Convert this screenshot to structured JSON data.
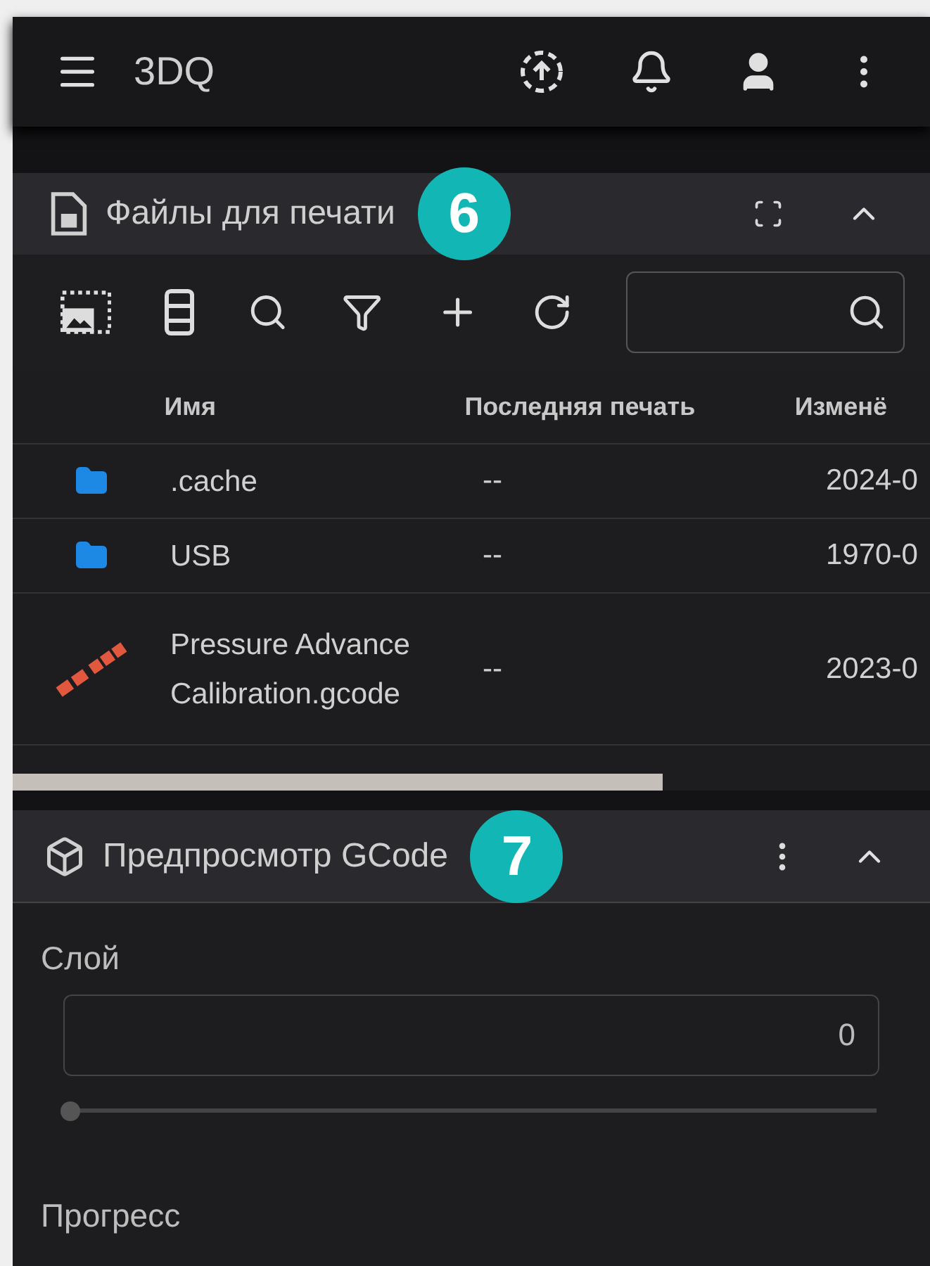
{
  "app_bar": {
    "title": "3DQ"
  },
  "files_panel": {
    "title": "Файлы для печати",
    "badge": "6",
    "table": {
      "columns": [
        "Имя",
        "Последняя печать",
        "Изменё"
      ],
      "rows": [
        {
          "kind": "folder",
          "name": ".cache",
          "last_print": "--",
          "modified": "2024-0"
        },
        {
          "kind": "folder",
          "name": "USB",
          "last_print": "--",
          "modified": "1970-0"
        },
        {
          "kind": "file",
          "name": "Pressure Advance Calibration.gcode",
          "last_print": "--",
          "modified": "2023-0"
        }
      ]
    }
  },
  "gcode_panel": {
    "title": "Предпросмотр GCode",
    "badge": "7",
    "layer": {
      "label": "Слой",
      "value": "0",
      "level": 0
    },
    "progress": {
      "label": "Прогресс"
    }
  }
}
